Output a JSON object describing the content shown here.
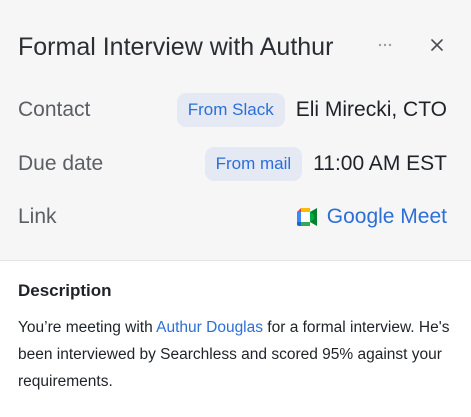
{
  "header": {
    "title": "Formal Interview with Authur",
    "more_icon": "ellipsis-icon",
    "close_icon": "close-icon"
  },
  "details": {
    "contact": {
      "label": "Contact",
      "source_chip": "From Slack",
      "value": "Eli Mirecki, CTO"
    },
    "due_date": {
      "label": "Due date",
      "source_chip": "From mail",
      "value": "11:00 AM EST"
    },
    "link": {
      "label": "Link",
      "icon": "google-meet-icon",
      "text": "Google Meet"
    }
  },
  "description": {
    "heading": "Description",
    "text_before": "You’re meeting with ",
    "person_link": "Authur Douglas",
    "text_after": " for a formal interview. He's been interviewed by Searchless and scored 95% against your requirements."
  },
  "colors": {
    "accent": "#2c6fd6",
    "chip_background": "#e4e9f4",
    "header_background": "#f6f6f7"
  }
}
